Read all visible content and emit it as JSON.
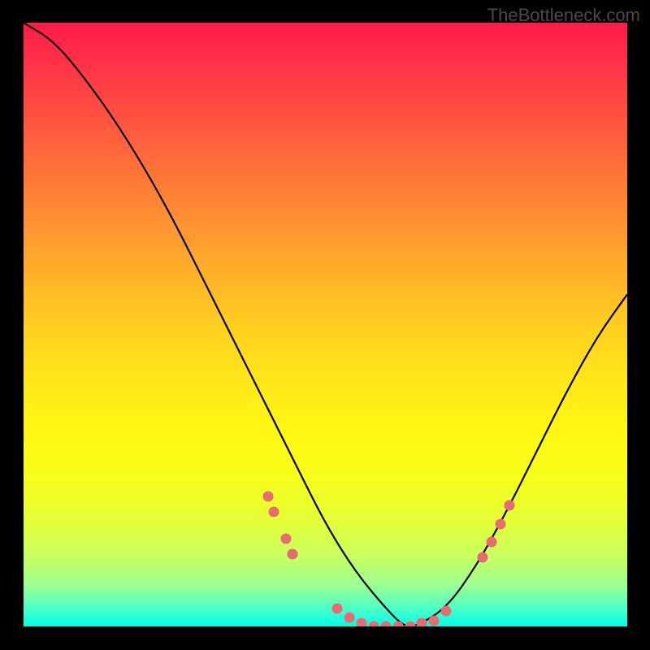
{
  "watermark": "TheBottleneck.com",
  "chart_data": {
    "type": "line",
    "title": "",
    "xlabel": "",
    "ylabel": "",
    "x_range": [
      0,
      100
    ],
    "y_range": [
      0,
      100
    ],
    "series": [
      {
        "name": "bottleneck-curve",
        "x": [
          0,
          5,
          10,
          15,
          20,
          25,
          30,
          35,
          40,
          45,
          50,
          55,
          60,
          63,
          65,
          70,
          75,
          80,
          85,
          90,
          95,
          100
        ],
        "y": [
          100,
          97,
          91,
          84,
          76,
          67,
          57,
          47,
          37,
          27,
          17,
          9,
          3,
          0,
          0,
          3,
          10,
          19,
          29,
          39,
          48,
          55
        ]
      }
    ],
    "markers": {
      "name": "highlight-dots",
      "points": [
        {
          "x": 40.5,
          "y": 21.5
        },
        {
          "x": 41.5,
          "y": 19
        },
        {
          "x": 43.5,
          "y": 14.5
        },
        {
          "x": 44.5,
          "y": 12
        },
        {
          "x": 52,
          "y": 3
        },
        {
          "x": 54,
          "y": 1.5
        },
        {
          "x": 56,
          "y": 0.5
        },
        {
          "x": 58,
          "y": 0
        },
        {
          "x": 60,
          "y": 0
        },
        {
          "x": 62,
          "y": 0
        },
        {
          "x": 64,
          "y": 0
        },
        {
          "x": 66,
          "y": 0.5
        },
        {
          "x": 68,
          "y": 1
        },
        {
          "x": 70,
          "y": 2.5
        },
        {
          "x": 76,
          "y": 11.5
        },
        {
          "x": 77.5,
          "y": 14
        },
        {
          "x": 79,
          "y": 17
        },
        {
          "x": 80.5,
          "y": 20
        }
      ]
    }
  }
}
